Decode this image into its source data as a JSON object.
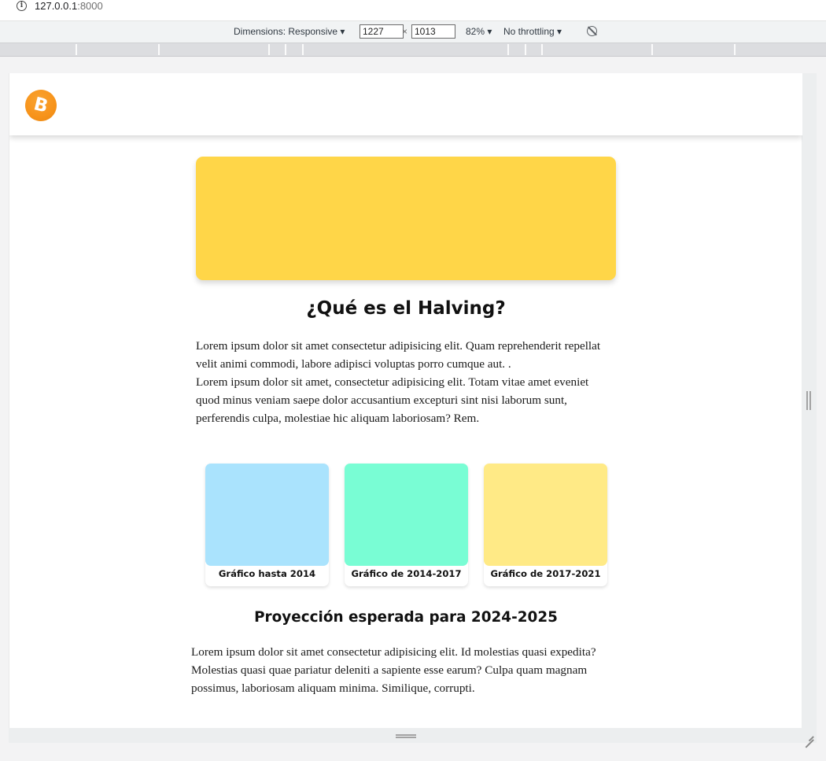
{
  "browser": {
    "url_host": "127.0.0.1",
    "url_port": ":8000",
    "info_icon": "info-icon"
  },
  "devtools": {
    "dimensions_label": "Dimensions: Responsive ▾",
    "width_value": "1227",
    "height_value": "1013",
    "times_sign": "×",
    "zoom_label": "82% ▾",
    "throttle_label": "No throttling ▾",
    "rotate_icon": "rotate-icon"
  },
  "navbar": {
    "logo_icon": "bitcoin-logo-icon",
    "logo_glyph": "B",
    "logo_color": "#f7931a"
  },
  "hero": {
    "color": "#ffd648"
  },
  "section1": {
    "title": "¿Qué es el Halving?",
    "paragraph1": "Lorem ipsum dolor sit amet consectetur adipisicing elit. Quam reprehenderit repellat velit animi commodi, labore adipisci voluptas porro cumque aut. .",
    "paragraph2": "Lorem ipsum dolor sit amet, consectetur adipisicing elit. Totam vitae amet eveniet quod minus veniam saepe dolor accusantium excepturi sint nisi laborum sunt, perferendis culpa, molestiae hic aliquam laboriosam? Rem."
  },
  "cards": [
    {
      "label": "Gráfico hasta 2014",
      "color": "#aae3fd"
    },
    {
      "label": "Gráfico de 2014-2017",
      "color": "#79fdd4"
    },
    {
      "label": "Gráfico de 2017-2021",
      "color": "#ffea86"
    }
  ],
  "section2": {
    "title": "Proyección esperada para 2024-2025",
    "paragraph": "Lorem ipsum dolor sit amet consectetur adipisicing elit. Id molestias quasi expedita? Molestias quasi quae pariatur deleniti a sapiente esse earum? Culpa quam magnam possimus, laboriosam aliquam minima. Similique, corrupti."
  }
}
